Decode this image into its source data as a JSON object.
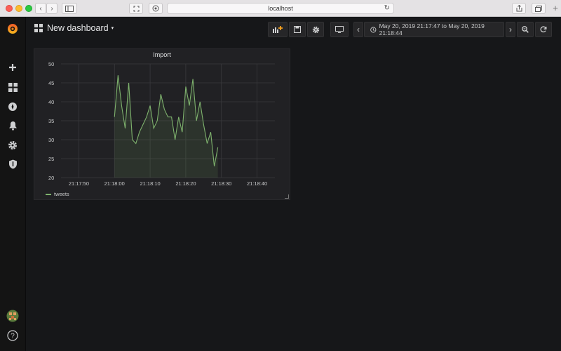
{
  "browser": {
    "url": "localhost",
    "traffic_colors": [
      "#fc5f57",
      "#fdbc2e",
      "#2ac940"
    ]
  },
  "sidebar": {
    "icons": [
      "grafana-logo-icon",
      "plus-icon",
      "dashboards-icon",
      "explore-icon",
      "bell-icon",
      "gear-icon",
      "shield-icon",
      "user-avatar",
      "help-icon"
    ],
    "help_label": "?"
  },
  "header": {
    "dashboard_title": "New dashboard",
    "time_range": "May 20, 2019 21:17:47 to May 20, 2019 21:18:44"
  },
  "panel": {
    "title": "Import"
  },
  "chart_data": {
    "type": "line",
    "title": "Import",
    "ylim": [
      20,
      50
    ],
    "yticks": [
      "50",
      "45",
      "40",
      "35",
      "30",
      "25",
      "20"
    ],
    "xticks": [
      "21:17:50",
      "21:18:00",
      "21:18:10",
      "21:18:20",
      "21:18:30",
      "21:18:40"
    ],
    "grid": true,
    "legend_position": "bottom-left",
    "series": [
      {
        "name": "tweets",
        "color": "#7eb26d",
        "x": [
          "21:18:00",
          "21:18:01",
          "21:18:02",
          "21:18:03",
          "21:18:04",
          "21:18:05",
          "21:18:06",
          "21:18:07",
          "21:18:08",
          "21:18:09",
          "21:18:10",
          "21:18:11",
          "21:18:12",
          "21:18:13",
          "21:18:14",
          "21:18:15",
          "21:18:16",
          "21:18:17",
          "21:18:18",
          "21:18:19",
          "21:18:20",
          "21:18:21",
          "21:18:22",
          "21:18:23",
          "21:18:24",
          "21:18:25",
          "21:18:26",
          "21:18:27",
          "21:18:28",
          "21:18:29"
        ],
        "values": [
          36,
          47,
          39,
          33,
          45,
          30,
          29,
          32,
          34,
          36,
          39,
          33,
          35,
          42,
          38,
          36,
          36,
          30,
          36,
          32,
          44,
          39,
          46,
          35,
          40,
          34,
          29,
          32,
          23,
          28
        ]
      }
    ]
  }
}
